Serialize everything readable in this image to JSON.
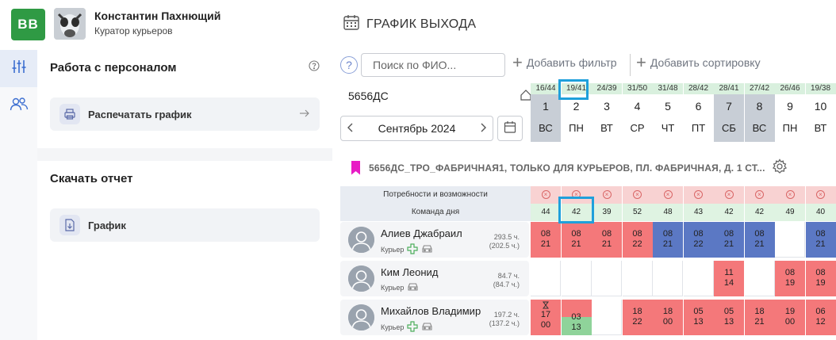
{
  "header": {
    "logo_text": "BB",
    "user_name": "Константин Пахнющий",
    "user_role": "Куратор курьеров",
    "page_title": "ГРАФИК ВЫХОДА"
  },
  "sidebar": {
    "section1_title": "Работа с персоналом",
    "print_label": "Распечатать график",
    "section2_title": "Скачать отчет",
    "report_label": "График"
  },
  "toolbar": {
    "help": "?",
    "search_placeholder": "Поиск по ФИО...",
    "add_filter": "Добавить фильтр",
    "add_sort": "Добавить сортировку"
  },
  "store_code": "5656ДС",
  "month": "Сентябрь 2024",
  "days": [
    {
      "ratio": "16/44",
      "num": "1",
      "wd": "ВС",
      "weekend": true
    },
    {
      "ratio": "19/41",
      "num": "2",
      "wd": "ПН",
      "weekend": false
    },
    {
      "ratio": "24/39",
      "num": "3",
      "wd": "ВТ",
      "weekend": false
    },
    {
      "ratio": "31/50",
      "num": "4",
      "wd": "СР",
      "weekend": false
    },
    {
      "ratio": "31/48",
      "num": "5",
      "wd": "ЧТ",
      "weekend": false
    },
    {
      "ratio": "28/42",
      "num": "6",
      "wd": "ПТ",
      "weekend": false
    },
    {
      "ratio": "28/41",
      "num": "7",
      "wd": "СБ",
      "weekend": true
    },
    {
      "ratio": "27/42",
      "num": "8",
      "wd": "ВС",
      "weekend": true
    },
    {
      "ratio": "26/46",
      "num": "9",
      "wd": "ПН",
      "weekend": false
    },
    {
      "ratio": "19/38",
      "num": "10",
      "wd": "ВТ",
      "weekend": false
    }
  ],
  "schedule": {
    "title": "5656ДС_ТРО_ФАБРИЧНАЯ1, ТОЛЬКО ДЛЯ КУРЬЕРОВ, ПЛ. ФАБРИЧНАЯ, Д. 1 СТ...",
    "needs_label": "Потребности и возможности",
    "team_label": "Команда дня",
    "team_counts": [
      "44",
      "42",
      "39",
      "52",
      "48",
      "43",
      "42",
      "42",
      "49",
      "40"
    ]
  },
  "employees": [
    {
      "name": "Алиев Джабраил",
      "role": "Курьер",
      "hours": "293.5 ч.",
      "hours_sub": "(202.5 ч.)",
      "shifts": [
        {
          "color": "red",
          "start": "08",
          "end": "21"
        },
        {
          "color": "red",
          "start": "08",
          "end": "21"
        },
        {
          "color": "red",
          "start": "08",
          "end": "21"
        },
        {
          "color": "red",
          "start": "08",
          "end": "22"
        },
        {
          "color": "blue",
          "start": "08",
          "end": "21"
        },
        {
          "color": "blue",
          "start": "08",
          "end": "22"
        },
        {
          "color": "blue",
          "start": "08",
          "end": "21"
        },
        {
          "color": "blue",
          "start": "08",
          "end": "21"
        },
        {
          "color": "empty",
          "start": "",
          "end": ""
        },
        {
          "color": "blue",
          "start": "08",
          "end": "21"
        }
      ]
    },
    {
      "name": "Ким Леонид",
      "role": "Курьер",
      "hours": "84.7 ч.",
      "hours_sub": "(84.7 ч.)",
      "shifts": [
        {
          "color": "empty",
          "start": "",
          "end": ""
        },
        {
          "color": "empty",
          "start": "",
          "end": ""
        },
        {
          "color": "empty",
          "start": "",
          "end": ""
        },
        {
          "color": "empty",
          "start": "",
          "end": ""
        },
        {
          "color": "empty",
          "start": "",
          "end": ""
        },
        {
          "color": "empty",
          "start": "",
          "end": ""
        },
        {
          "color": "red",
          "start": "11",
          "end": "14"
        },
        {
          "color": "empty",
          "start": "",
          "end": ""
        },
        {
          "color": "red",
          "start": "08",
          "end": "19"
        },
        {
          "color": "red",
          "start": "08",
          "end": "19"
        }
      ]
    },
    {
      "name": "Михайлов Владимир",
      "role": "Курьер",
      "hours": "197.2 ч.",
      "hours_sub": "(137.2 ч.)",
      "shifts": [
        {
          "color": "red",
          "start": "17",
          "end": "00"
        },
        {
          "color": "split",
          "start": "03",
          "end": "13"
        },
        {
          "color": "empty",
          "start": "",
          "end": ""
        },
        {
          "color": "red",
          "start": "18",
          "end": "22"
        },
        {
          "color": "red",
          "start": "18",
          "end": "00"
        },
        {
          "color": "red",
          "start": "05",
          "end": "13"
        },
        {
          "color": "red",
          "start": "05",
          "end": "13"
        },
        {
          "color": "red",
          "start": "18",
          "end": "21"
        },
        {
          "color": "red",
          "start": "19",
          "end": "00"
        },
        {
          "color": "red",
          "start": "06",
          "end": "12"
        }
      ]
    }
  ]
}
